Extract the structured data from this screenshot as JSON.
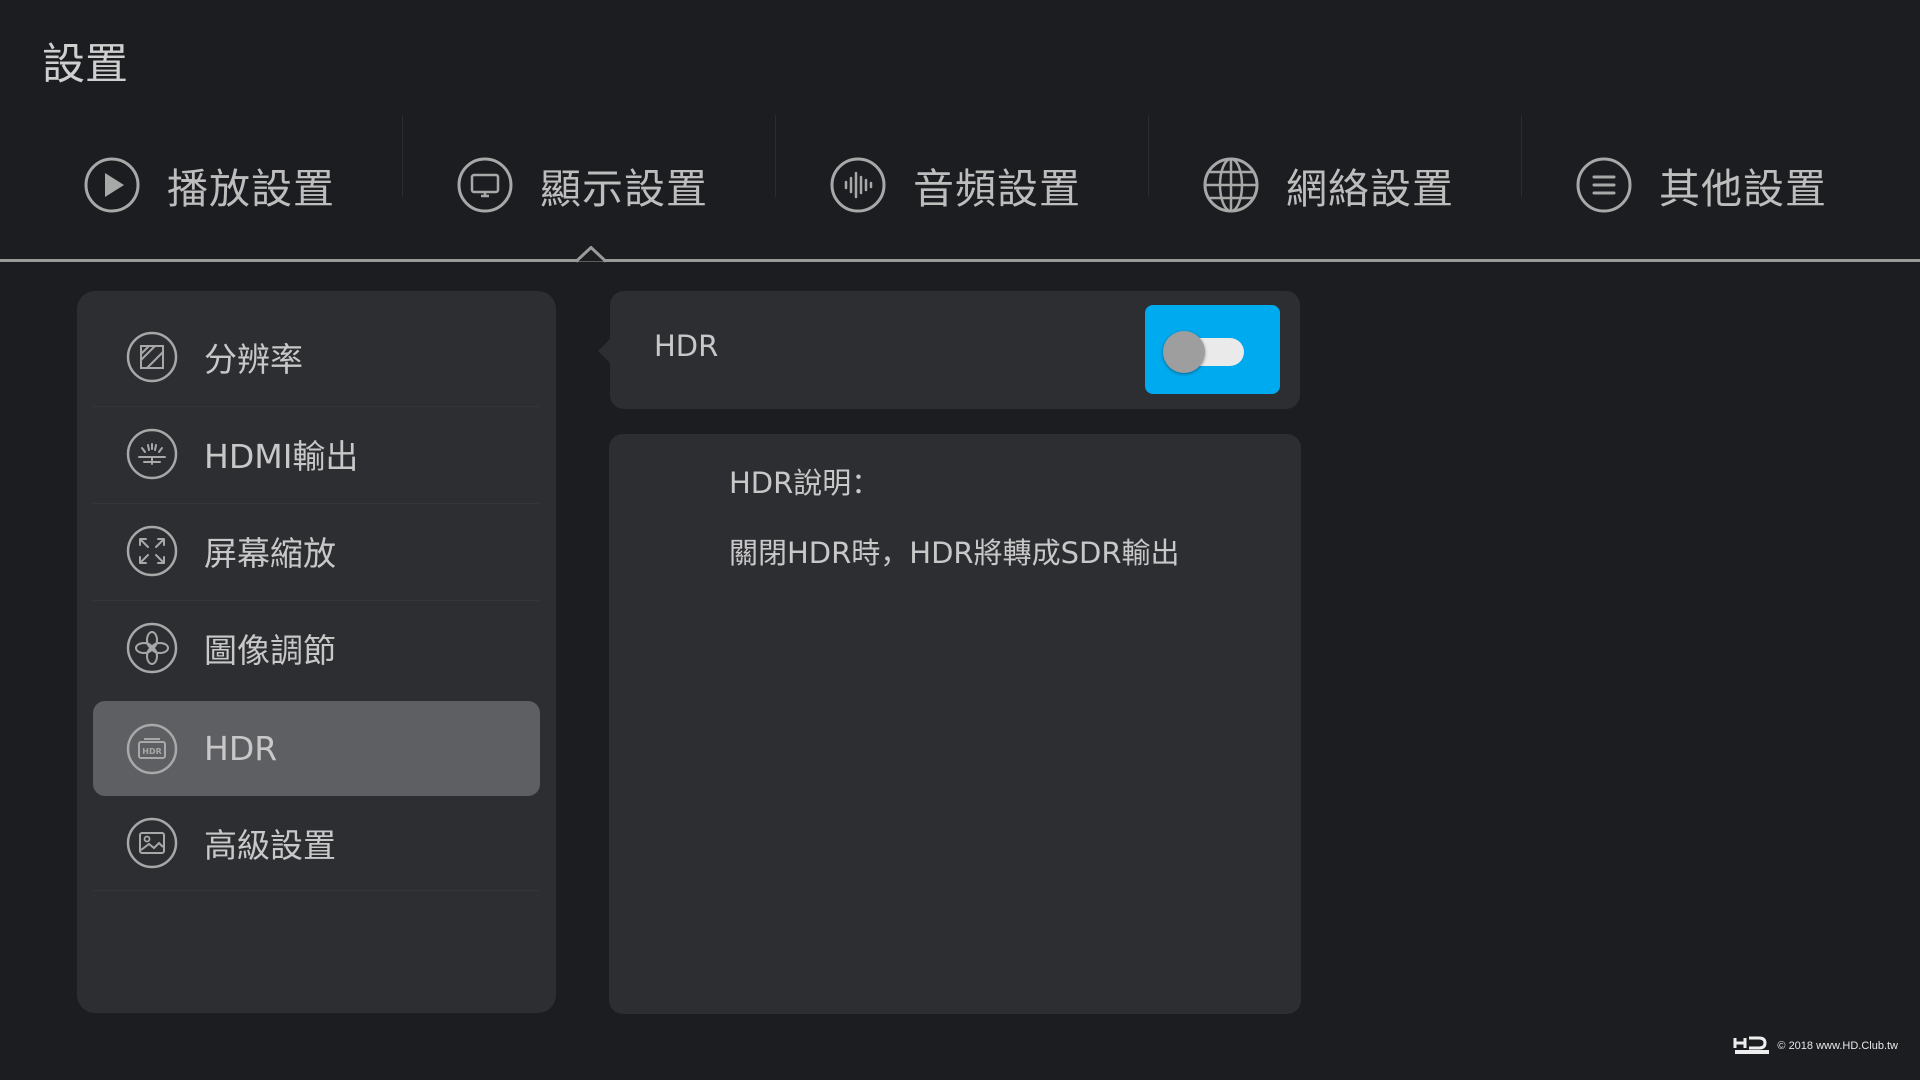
{
  "page_title": "設置",
  "tabs": [
    {
      "label": "播放設置",
      "icon": "play-icon"
    },
    {
      "label": "顯示設置",
      "icon": "monitor-icon"
    },
    {
      "label": "音頻設置",
      "icon": "audio-wave-icon"
    },
    {
      "label": "網絡設置",
      "icon": "globe-icon"
    },
    {
      "label": "其他設置",
      "icon": "menu-lines-icon"
    }
  ],
  "selected_tab": "顯示設置",
  "sidebar": {
    "items": [
      {
        "label": "分辨率",
        "icon": "resolution-icon"
      },
      {
        "label": "HDMI輸出",
        "icon": "hdmi-output-icon"
      },
      {
        "label": "屏幕縮放",
        "icon": "screen-zoom-icon"
      },
      {
        "label": "圖像調節",
        "icon": "image-adjust-icon"
      },
      {
        "label": "HDR",
        "icon": "hdr-icon"
      },
      {
        "label": "高級設置",
        "icon": "advanced-image-icon"
      }
    ],
    "selected": "HDR"
  },
  "hdr_setting": {
    "label": "HDR",
    "toggle_on": false,
    "accent_color": "#00aaee"
  },
  "description": {
    "title": "HDR說明：",
    "text": "關閉HDR時，HDR將轉成SDR輸出"
  },
  "footer": {
    "logo": "HD CLUB",
    "copyright": "© 2018 www.HD.Club.tw"
  }
}
